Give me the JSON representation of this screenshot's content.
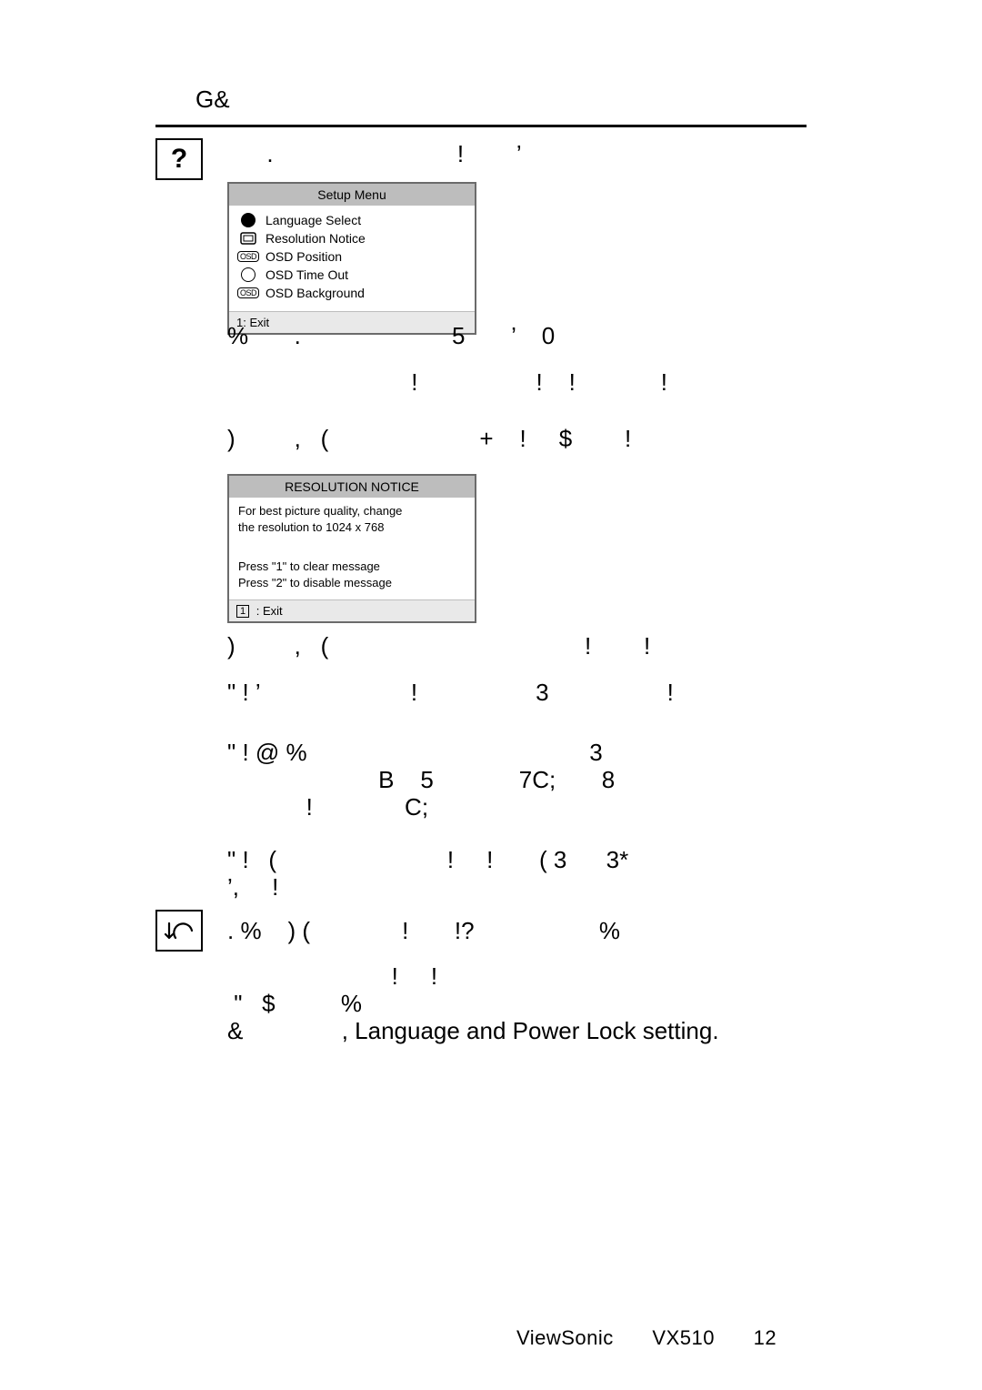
{
  "header": {
    "title": "G&"
  },
  "icon_q_label": "?",
  "setup_menu": {
    "title": "Setup Menu",
    "items": [
      {
        "label": "Language   Select"
      },
      {
        "label": "Resolution   Notice"
      },
      {
        "label": "OSD   Position"
      },
      {
        "label": "OSD   Time Out"
      },
      {
        "label": "OSD Background"
      }
    ],
    "exit": "1: Exit"
  },
  "res_notice": {
    "title": "RESOLUTION NOTICE",
    "body1": "For best picture quality, change",
    "body2": "the resolution to 1024 x 768",
    "hint1": "Press \"1\" to clear message",
    "hint2": "Press \"2\" to disable message",
    "exit_box": "1",
    "exit_label": " : Exit"
  },
  "rows": {
    "r0": "      .                            !        ’",
    "r1": "%       .                       5       ’    0",
    "r2": "                            !                  !    !             !",
    "r3": ")         ,   (                       +    !     $        !",
    "r4": ")         ,   (                                       !        !",
    "r5": "\" ! ’                       !                  3                  !",
    "r6": "\" ! @ %                                           3",
    "r7": "                       B    5             7C;       8",
    "r8": "            !              C;",
    "r9": "\" !   (                          !     !       ( 3      3*",
    "r10": "’,     !",
    "r11": ". %    ) (              !       !?                   %",
    "r12": "                         !     !",
    "r13": " \"   $          %",
    "r14": "&               , Language and Power Lock setting."
  },
  "footer": {
    "brand": "ViewSonic",
    "model": "VX510",
    "page": "12"
  }
}
